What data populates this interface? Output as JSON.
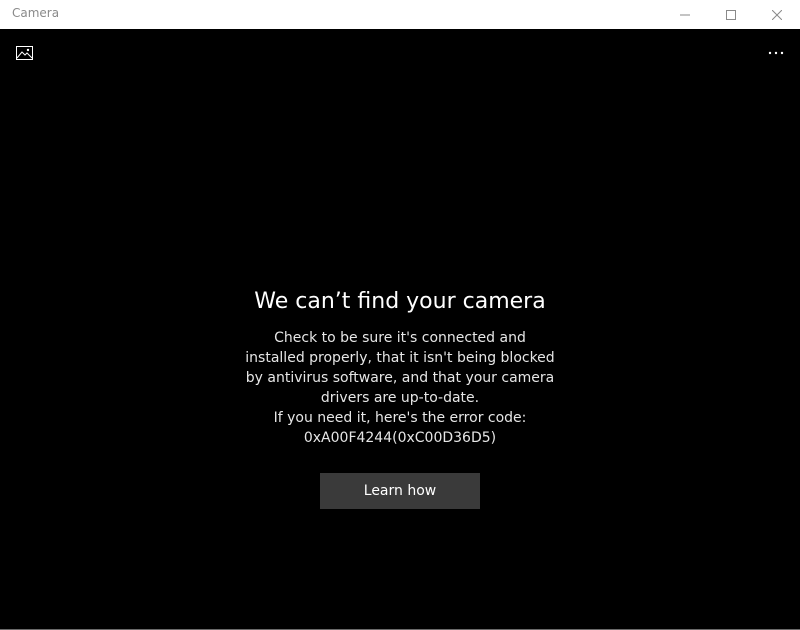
{
  "window": {
    "title": "Camera",
    "controls": {
      "minimize_icon": "minimize-icon",
      "maximize_icon": "maximize-icon",
      "close_icon": "close-icon"
    }
  },
  "toolbar": {
    "gallery_icon": "photo-gallery-icon",
    "more_icon": "more-options-icon",
    "more_glyph": "···"
  },
  "error": {
    "heading": "We can’t find your camera",
    "lines": [
      "Check to be sure it's connected and",
      "installed properly, that it isn't being blocked",
      "by antivirus software, and that your camera",
      "drivers are up-to-date.",
      "If you need it, here's the error code:",
      "0xA00F4244(0xC00D36D5)"
    ],
    "button_label": "Learn how"
  },
  "colors": {
    "background": "#000000",
    "titlebar": "#ffffff",
    "button": "#3a3a3a",
    "text": "#ffffff"
  }
}
